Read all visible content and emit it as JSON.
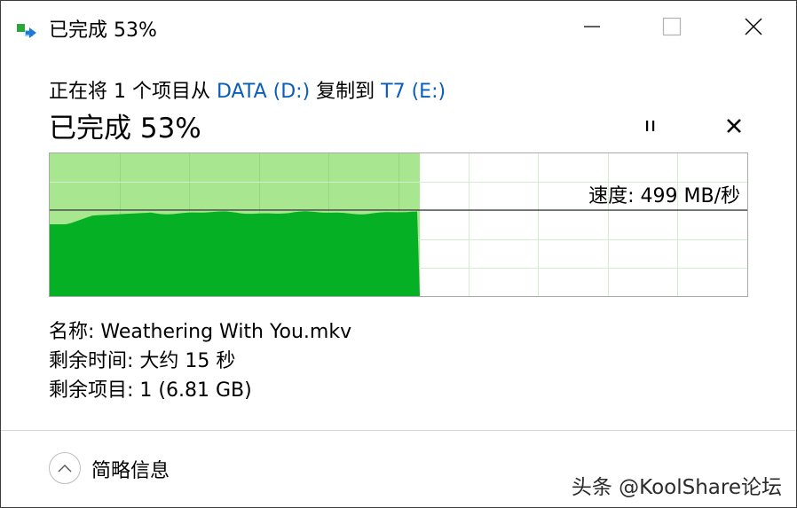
{
  "window": {
    "title": "已完成 53%"
  },
  "copy": {
    "prefix": "正在将 1 个项目从 ",
    "source": "DATA (D:)",
    "middle": " 复制到 ",
    "destination": "T7 (E:)",
    "status": "已完成 53%",
    "progress_percent": 53,
    "speed_label": "速度: 499 MB/秒"
  },
  "details": {
    "name_label": "名称: ",
    "name_value": "Weathering With You.mkv",
    "time_label": "剩余时间: ",
    "time_value": "大约 15 秒",
    "items_label": "剩余项目: ",
    "items_value": "1 (6.81 GB)"
  },
  "footer": {
    "toggle_label": "简略信息"
  },
  "watermark": "头条 @KoolShare论坛",
  "colors": {
    "progress_bg": "#a8e690",
    "throughput_fill": "#06b025",
    "link": "#0a5db8"
  }
}
